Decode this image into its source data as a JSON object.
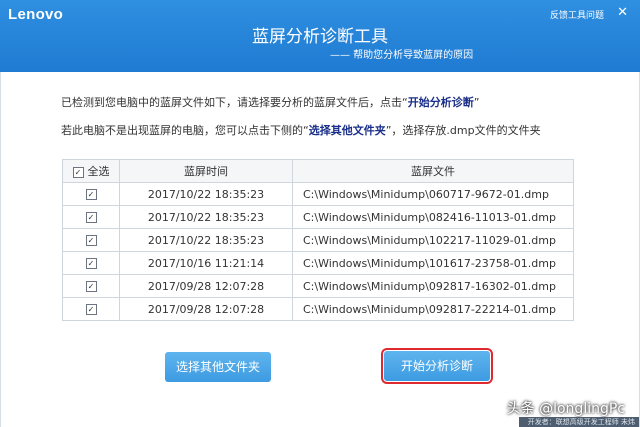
{
  "header": {
    "logo": "Lenovo",
    "feedback_label": "反馈工具问题",
    "close_glyph": "✕",
    "title": "蓝屏分析诊断工具",
    "subtitle": "—— 帮助您分析导致蓝屏的原因"
  },
  "info": {
    "line1_prefix": "已检测到您电脑中的蓝屏文件如下，请选择要分析的蓝屏文件后，点击“",
    "line1_highlight": "开始分析诊断",
    "line1_suffix": "”",
    "line2_prefix": "若此电脑不是出现蓝屏的电脑，您可以点击下侧的“",
    "line2_highlight": "选择其他文件夹",
    "line2_suffix": "”，选择存放.dmp文件的文件夹"
  },
  "table": {
    "select_all_label": "全选",
    "columns": [
      "蓝屏时间",
      "蓝屏文件"
    ],
    "rows": [
      {
        "time": "2017/10/22 18:35:23",
        "file": "C:\\Windows\\Minidump\\060717-9672-01.dmp"
      },
      {
        "time": "2017/10/22 18:35:23",
        "file": "C:\\Windows\\Minidump\\082416-11013-01.dmp"
      },
      {
        "time": "2017/10/22 18:35:23",
        "file": "C:\\Windows\\Minidump\\102217-11029-01.dmp"
      },
      {
        "time": "2017/10/16 11:21:14",
        "file": "C:\\Windows\\Minidump\\101617-23758-01.dmp"
      },
      {
        "time": "2017/09/28 12:07:28",
        "file": "C:\\Windows\\Minidump\\092817-16302-01.dmp"
      },
      {
        "time": "2017/09/28 12:07:28",
        "file": "C:\\Windows\\Minidump\\092817-22214-01.dmp"
      }
    ]
  },
  "buttons": {
    "other_folder": "选择其他文件夹",
    "start": "开始分析诊断"
  },
  "watermark": "头条 @longlingPc",
  "footer": "开发者：联想高级开发工程师 未炜"
}
